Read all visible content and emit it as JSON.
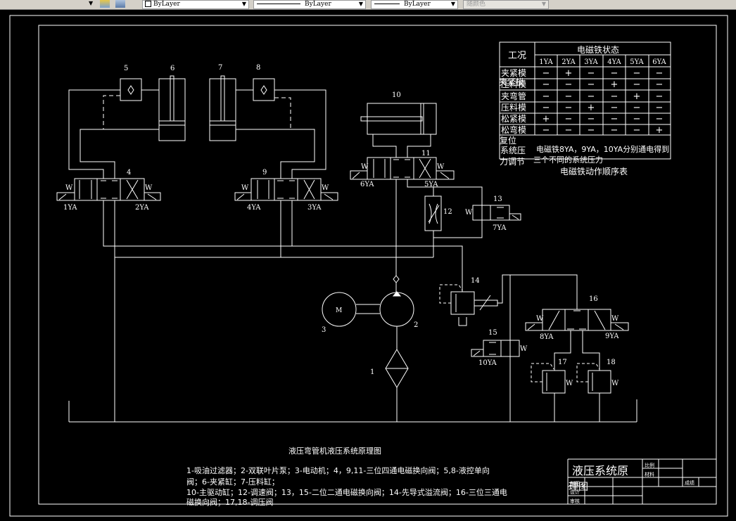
{
  "toolbar": {
    "color_combo": "ByLayer",
    "linetype_combo": "ByLayer",
    "lineweight_combo": "ByLayer",
    "plotstyle_combo": "随颜色"
  },
  "labels": {
    "c1": "1",
    "c2": "2",
    "c3": "3",
    "c4": "4",
    "c5": "5",
    "c6": "6",
    "c7": "7",
    "c8": "8",
    "c9": "9",
    "c10": "10",
    "c11": "11",
    "c12": "12",
    "c13": "13",
    "c14": "14",
    "c15": "15",
    "c16": "16",
    "c17": "17",
    "c18": "18",
    "motor": "M",
    "ya1": "1YA",
    "ya2": "2YA",
    "ya3": "3YA",
    "ya4": "4YA",
    "ya5": "5YA",
    "ya6": "6YA",
    "ya7": "7YA",
    "ya8": "8YA",
    "ya9": "9YA",
    "ya10": "10YA",
    "spring": "W"
  },
  "table": {
    "corner": "工况",
    "group_header": "电磁铁状态",
    "columns": [
      "1YA",
      "2YA",
      "3YA",
      "4YA",
      "5YA",
      "6YA"
    ],
    "rows": [
      {
        "label": "夹紧模",
        "overlap": "",
        "values": [
          "−",
          "+",
          "−",
          "−",
          "−",
          "−"
        ]
      },
      {
        "label": "压料模",
        "overlap": "夹紧模",
        "values": [
          "−",
          "−",
          "−",
          "+",
          "−",
          "−"
        ]
      },
      {
        "label": "夹弯管",
        "overlap": "",
        "values": [
          "−",
          "−",
          "−",
          "−",
          "+",
          "−"
        ]
      },
      {
        "label": "压料模",
        "overlap": "",
        "values": [
          "−",
          "−",
          "+",
          "−",
          "−",
          "−"
        ]
      },
      {
        "label": "松紧模",
        "overlap": "",
        "values": [
          "+",
          "−",
          "−",
          "−",
          "−",
          "−"
        ]
      },
      {
        "label": "松弯模",
        "overlap": "",
        "values": [
          "−",
          "−",
          "−",
          "−",
          "−",
          "+"
        ]
      }
    ],
    "reset_label": "复位",
    "pressure_label_1": "系统压",
    "pressure_label_2": "力调节",
    "pressure_note_1": "电磁铁8YA，9YA，10YA分别通电得到",
    "pressure_note_2": "三个不同的系统压力",
    "caption": "电磁铁动作顺序表"
  },
  "drawing": {
    "title": "液压弯管机液压系统原理图",
    "legend": [
      "1-吸油过滤器；2-双联叶片泵；3-电动机；4，9,11-三位四通电磁换向阀；5,8-液控单向",
      "阀；6-夹紧缸；7-压料缸；",
      "10-主驱动缸；12-调速阀；13，15-二位二通电磁换向阀；14-先导式溢流阀；16-三位三通电",
      "磁换向阀；17,18-调压阀"
    ]
  },
  "title_block": {
    "title_1": "液压系统原",
    "title_2": "理图",
    "scale": "比例",
    "material": "材料",
    "grade": "成绩",
    "drawn": "制图",
    "design": "设计",
    "review": "审核"
  }
}
